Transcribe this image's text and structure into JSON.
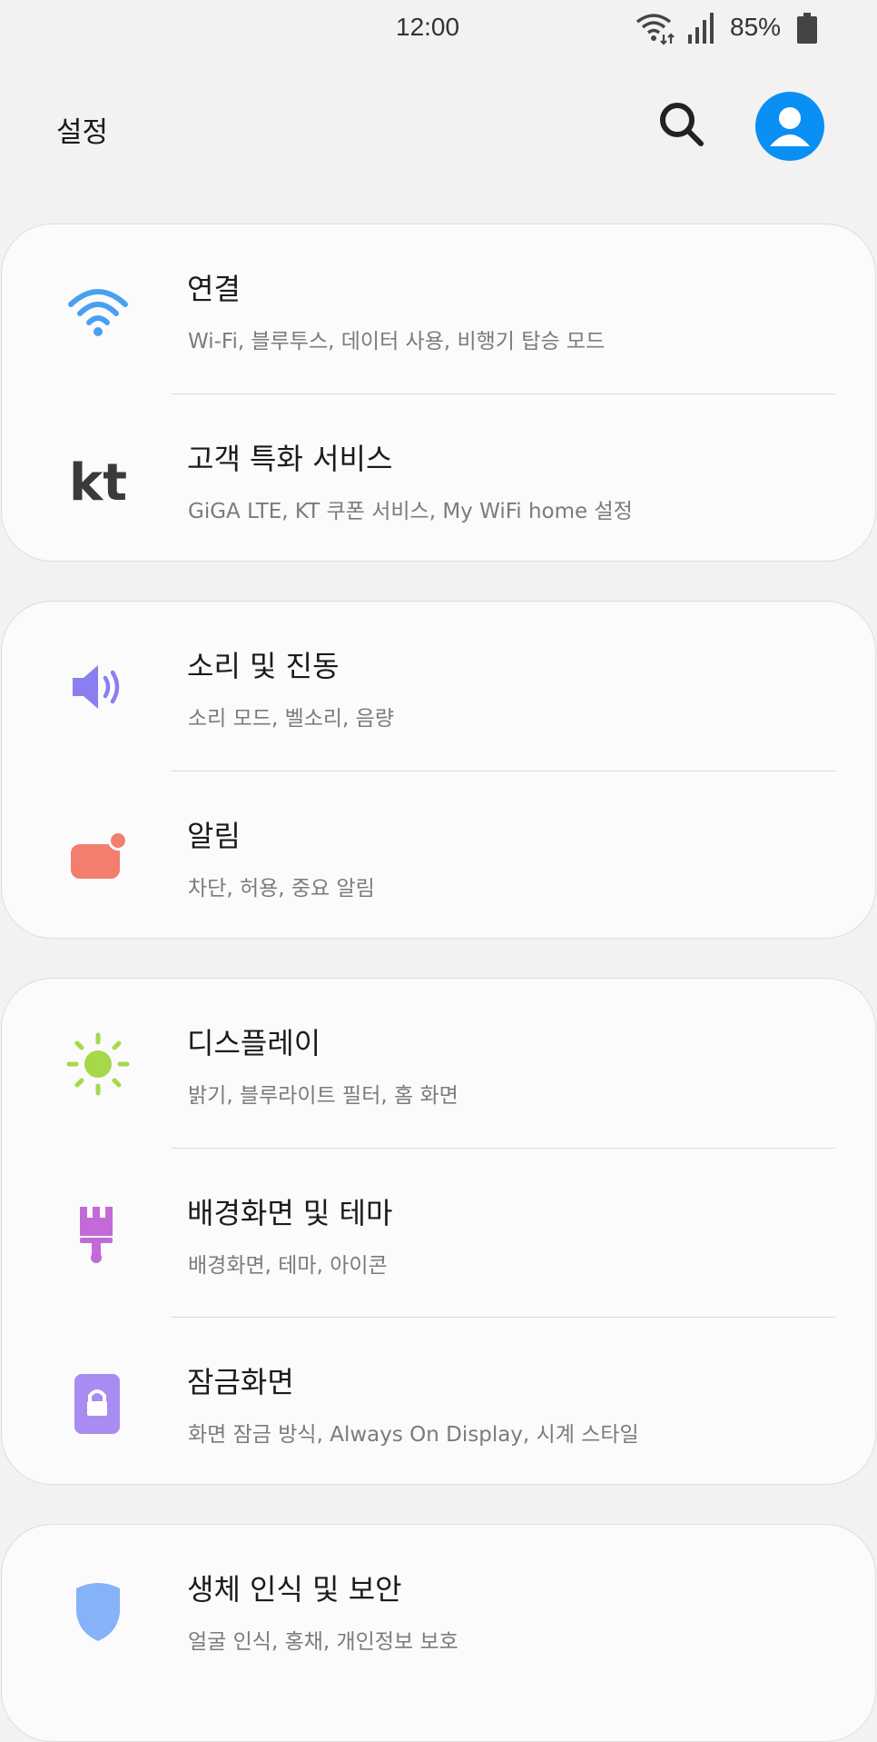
{
  "status_bar": {
    "time": "12:00",
    "battery": "85%"
  },
  "header": {
    "title": "설정"
  },
  "groups": [
    {
      "items": [
        {
          "title": "연결",
          "subtitle": "Wi-Fi, 블루투스, 데이터 사용, 비행기 탑승 모드",
          "icon": "wifi-icon",
          "color": "#4aa0f0"
        },
        {
          "title": "고객 특화 서비스",
          "subtitle": "GiGA LTE, KT 쿠폰 서비스, My WiFi home 설정",
          "icon": "kt-logo-icon",
          "logo_text": "kt",
          "color": "#3a3a3a"
        }
      ]
    },
    {
      "items": [
        {
          "title": "소리 및 진동",
          "subtitle": "소리 모드, 벨소리, 음량",
          "icon": "speaker-icon",
          "color": "#8a7ff0"
        },
        {
          "title": "알림",
          "subtitle": "차단, 허용, 중요 알림",
          "icon": "notification-icon",
          "color": "#f27e70"
        }
      ]
    },
    {
      "items": [
        {
          "title": "디스플레이",
          "subtitle": "밝기, 블루라이트 필터, 홈 화면",
          "icon": "sun-icon",
          "color": "#a6d84a"
        },
        {
          "title": "배경화면 및 테마",
          "subtitle": "배경화면, 테마, 아이콘",
          "icon": "brush-icon",
          "color": "#c36ad8"
        },
        {
          "title": "잠금화면",
          "subtitle": "화면 잠금 방식, Always On Display, 시계 스타일",
          "icon": "lock-icon",
          "color": "#a98cf2"
        }
      ]
    },
    {
      "items": [
        {
          "title": "생체 인식 및 보안",
          "subtitle": "얼굴 인식, 홍채, 개인정보 보호",
          "icon": "shield-icon",
          "color": "#86b2f7"
        }
      ]
    }
  ]
}
